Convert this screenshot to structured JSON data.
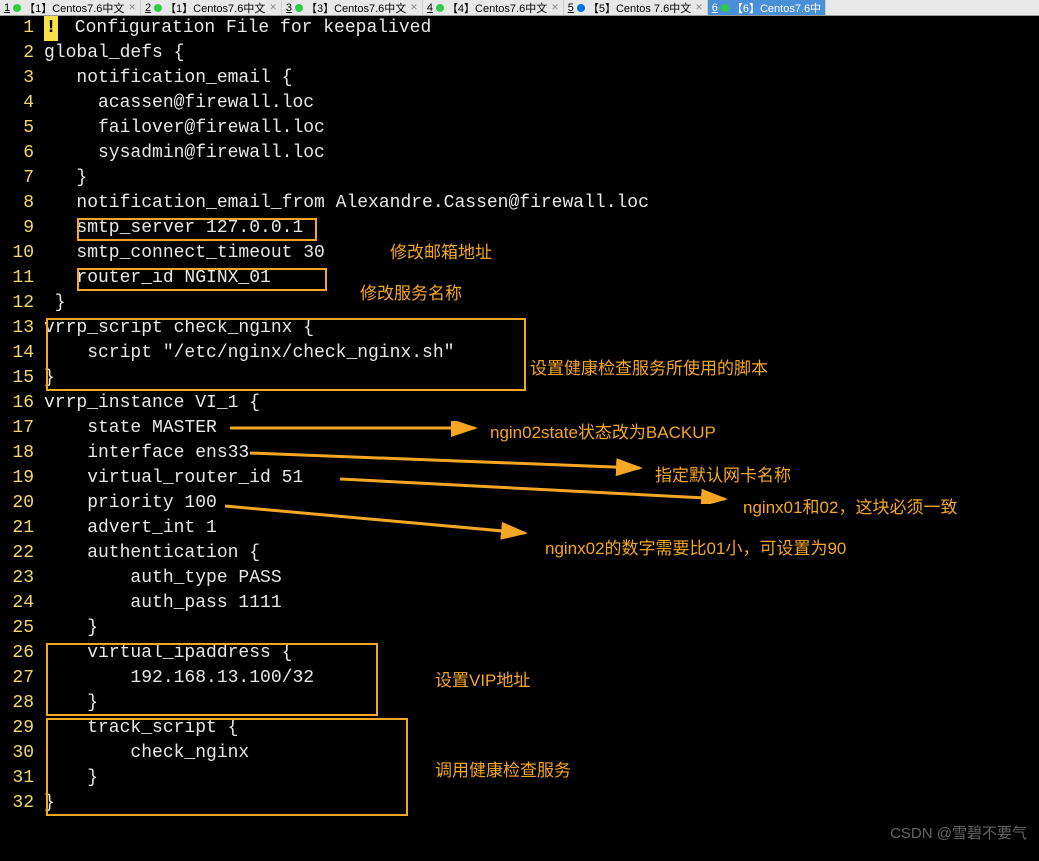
{
  "tabs": [
    {
      "num": "1",
      "label": "【1】Centos7.6中文",
      "dot": "green"
    },
    {
      "num": "2",
      "label": "【1】Centos7.6中文",
      "dot": "green"
    },
    {
      "num": "3",
      "label": "【3】Centos7.6中文",
      "dot": "green"
    },
    {
      "num": "4",
      "label": "【4】Centos7.6中文",
      "dot": "green"
    },
    {
      "num": "5",
      "label": "【5】Centos 7.6中文",
      "dot": "blue"
    },
    {
      "num": "6",
      "label": "【6】Centos7.6中",
      "dot": "green",
      "active": true
    }
  ],
  "lines": {
    "l1": " Configuration File for keepalived",
    "l2": "global_defs {",
    "l3": "   notification_email {",
    "l4": "     acassen@firewall.loc",
    "l5": "     failover@firewall.loc",
    "l6": "     sysadmin@firewall.loc",
    "l7": "   }",
    "l8": "   notification_email_from Alexandre.Cassen@firewall.loc",
    "l9": "   smtp_server 127.0.0.1",
    "l10": "   smtp_connect_timeout 30",
    "l11": "   router_id NGINX_01",
    "l12": " }",
    "l13": "vrrp_script check_nginx {",
    "l14": "    script \"/etc/nginx/check_nginx.sh\"",
    "l15": "}",
    "l16": "vrrp_instance VI_1 {",
    "l17": "    state MASTER",
    "l18": "    interface ens33",
    "l19": "    virtual_router_id 51",
    "l20": "    priority 100",
    "l21": "    advert_int 1",
    "l22": "    authentication {",
    "l23": "        auth_type PASS",
    "l24": "        auth_pass 1111",
    "l25": "    }",
    "l26": "    virtual_ipaddress {",
    "l27": "        192.168.13.100/32",
    "l28": "    }",
    "l29": "    track_script {",
    "l30": "        check_nginx",
    "l31": "    }",
    "l32": "}"
  },
  "nums": {
    "n1": "1",
    "n2": "2",
    "n3": "3",
    "n4": "4",
    "n5": "5",
    "n6": "6",
    "n7": "7",
    "n8": "8",
    "n9": "9",
    "n10": "10",
    "n11": "11",
    "n12": "12",
    "n13": "13",
    "n14": "14",
    "n15": "15",
    "n16": "16",
    "n17": "17",
    "n18": "18",
    "n19": "19",
    "n20": "20",
    "n21": "21",
    "n22": "22",
    "n23": "23",
    "n24": "24",
    "n25": "25",
    "n26": "26",
    "n27": "27",
    "n28": "28",
    "n29": "29",
    "n30": "30",
    "n31": "31",
    "n32": "32"
  },
  "anno": {
    "a1": "修改邮箱地址",
    "a2": "修改服务名称",
    "a3": "设置健康检查服务所使用的脚本",
    "a4": "ngin02state状态改为BACKUP",
    "a5": "指定默认网卡名称",
    "a6": "nginx01和02，这块必须一致",
    "a7": "nginx02的数字需要比01小，可设置为90",
    "a8": "设置VIP地址",
    "a9": "调用健康检查服务"
  },
  "watermark": "CSDN @雪碧不要气",
  "excl": "!"
}
